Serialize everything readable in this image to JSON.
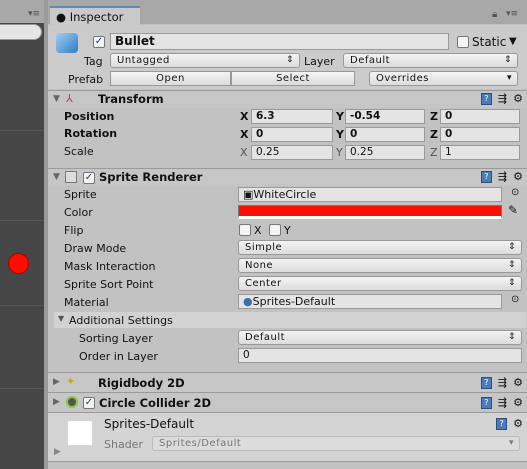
{
  "inspector": {
    "tab": "Inspector",
    "tab_icon": "info-icon"
  },
  "object": {
    "name": "Bullet",
    "active": true,
    "static_label": "Static",
    "static": false,
    "tag_label": "Tag",
    "tag": "Untagged",
    "layer_label": "Layer",
    "layer": "Default",
    "prefab_label": "Prefab",
    "open": "Open",
    "select": "Select",
    "overrides": "Overrides"
  },
  "transform": {
    "title": "Transform",
    "position_label": "Position",
    "rotation_label": "Rotation",
    "scale_label": "Scale",
    "position": {
      "x": "6.3",
      "y": "-0.54",
      "z": "0"
    },
    "rotation": {
      "x": "0",
      "y": "0",
      "z": "0"
    },
    "scale": {
      "x": "0.25",
      "y": "0.25",
      "z": "1"
    },
    "axes": {
      "x": "X",
      "y": "Y",
      "z": "Z"
    }
  },
  "sprite_renderer": {
    "title": "Sprite Renderer",
    "enabled": true,
    "sprite_label": "Sprite",
    "sprite": "WhiteCircle",
    "color_label": "Color",
    "color": "#ff0d00",
    "flip_label": "Flip",
    "flip_x": "X",
    "flip_y": "Y",
    "draw_mode_label": "Draw Mode",
    "draw_mode": "Simple",
    "mask_label": "Mask Interaction",
    "mask": "None",
    "sort_point_label": "Sprite Sort Point",
    "sort_point": "Center",
    "material_label": "Material",
    "material": "Sprites-Default",
    "additional": "Additional Settings",
    "sorting_layer_label": "Sorting Layer",
    "sorting_layer": "Default",
    "order_label": "Order in Layer",
    "order": "0"
  },
  "rigidbody": {
    "title": "Rigidbody 2D"
  },
  "collider": {
    "title": "Circle Collider 2D",
    "enabled": true
  },
  "material_asset": {
    "name": "Sprites-Default",
    "shader_label": "Shader",
    "shader": "Sprites/Default"
  }
}
